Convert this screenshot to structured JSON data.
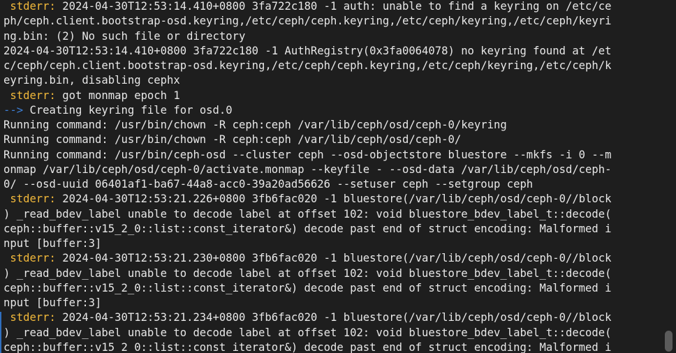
{
  "terminal": {
    "lines": [
      [
        {
          "t": " stderr:",
          "c": "label"
        },
        {
          "t": " 2024-04-30T12:53:14.410+0800 3fa722c180 -1 auth: unable to find a keyring on /etc/ce",
          "c": "text"
        }
      ],
      [
        {
          "t": "ph/ceph.client.bootstrap-osd.keyring,/etc/ceph/ceph.keyring,/etc/ceph/keyring,/etc/ceph/keyri",
          "c": "text"
        }
      ],
      [
        {
          "t": "ng.bin: (2) No such file or directory",
          "c": "text"
        }
      ],
      [
        {
          "t": "2024-04-30T12:53:14.410+0800 3fa722c180 -1 AuthRegistry(0x3fa0064078) no keyring found at /et",
          "c": "text"
        }
      ],
      [
        {
          "t": "c/ceph/ceph.client.bootstrap-osd.keyring,/etc/ceph/ceph.keyring,/etc/ceph/keyring,/etc/ceph/k",
          "c": "text"
        }
      ],
      [
        {
          "t": "eyring.bin, disabling cephx",
          "c": "text"
        }
      ],
      [
        {
          "t": " stderr:",
          "c": "label"
        },
        {
          "t": " got monmap epoch 1",
          "c": "text"
        }
      ],
      [
        {
          "t": "-->",
          "c": "arrow"
        },
        {
          "t": " Creating keyring file for osd.0",
          "c": "text"
        }
      ],
      [
        {
          "t": "Running command: /usr/bin/chown -R ceph:ceph /var/lib/ceph/osd/ceph-0/keyring",
          "c": "text"
        }
      ],
      [
        {
          "t": "Running command: /usr/bin/chown -R ceph:ceph /var/lib/ceph/osd/ceph-0/",
          "c": "text"
        }
      ],
      [
        {
          "t": "Running command: /usr/bin/ceph-osd --cluster ceph --osd-objectstore bluestore --mkfs -i 0 --m",
          "c": "text"
        }
      ],
      [
        {
          "t": "onmap /var/lib/ceph/osd/ceph-0/activate.monmap --keyfile - --osd-data /var/lib/ceph/osd/ceph-",
          "c": "text"
        }
      ],
      [
        {
          "t": "0/ --osd-uuid 06401af1-ba67-44a8-acc0-39a20ad56626 --setuser ceph --setgroup ceph",
          "c": "text"
        }
      ],
      [
        {
          "t": " stderr:",
          "c": "label"
        },
        {
          "t": " 2024-04-30T12:53:21.226+0800 3fb6fac020 -1 bluestore(/var/lib/ceph/osd/ceph-0//block",
          "c": "text"
        }
      ],
      [
        {
          "t": ") _read_bdev_label unable to decode label at offset 102: void bluestore_bdev_label_t::decode(",
          "c": "text"
        }
      ],
      [
        {
          "t": "ceph::buffer::v15_2_0::list::const_iterator&) decode past end of struct encoding: Malformed i",
          "c": "text"
        }
      ],
      [
        {
          "t": "nput [buffer:3]",
          "c": "text"
        }
      ],
      [
        {
          "t": " stderr:",
          "c": "label"
        },
        {
          "t": " 2024-04-30T12:53:21.230+0800 3fb6fac020 -1 bluestore(/var/lib/ceph/osd/ceph-0//block",
          "c": "text"
        }
      ],
      [
        {
          "t": ") _read_bdev_label unable to decode label at offset 102: void bluestore_bdev_label_t::decode(",
          "c": "text"
        }
      ],
      [
        {
          "t": "ceph::buffer::v15_2_0::list::const_iterator&) decode past end of struct encoding: Malformed i",
          "c": "text"
        }
      ],
      [
        {
          "t": "nput [buffer:3]",
          "c": "text"
        }
      ],
      [
        {
          "t": " stderr:",
          "c": "label"
        },
        {
          "t": " 2024-04-30T12:53:21.234+0800 3fb6fac020 -1 bluestore(/var/lib/ceph/osd/ceph-0//block",
          "c": "text"
        }
      ],
      [
        {
          "t": ") _read_bdev_label unable to decode label at offset 102: void bluestore_bdev_label_t::decode(",
          "c": "text"
        }
      ],
      [
        {
          "t": "ceph::buffer::v15_2_0::list::const_iterator&) decode past end of struct encoding: Malformed i",
          "c": "text"
        }
      ]
    ]
  },
  "colors": {
    "background": "#1e1e1e",
    "text": "#e8e8e8",
    "stderr_label": "#f2b93b",
    "arrow": "#3d7fd6",
    "gutter_mark": "#2f6fbf",
    "scroll_thumb": "#5b5b5b"
  }
}
